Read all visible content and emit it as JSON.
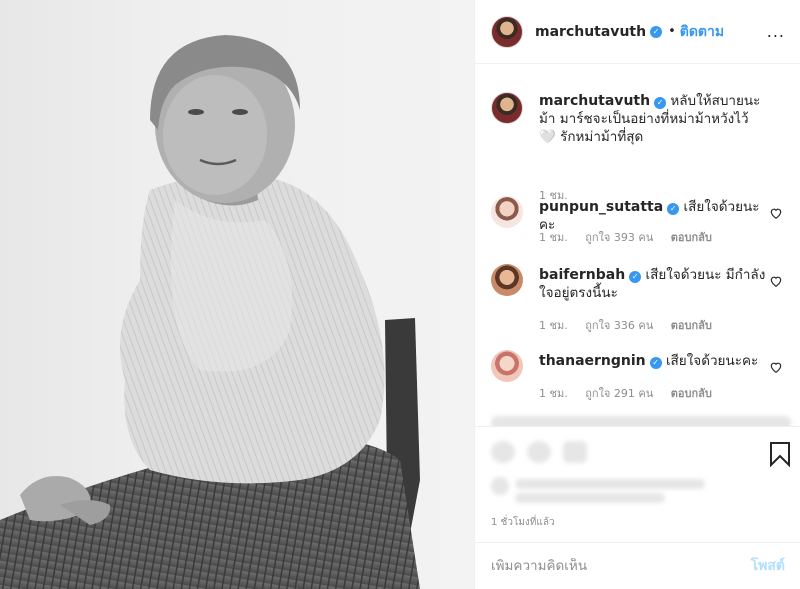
{
  "header": {
    "username": "marchutavuth",
    "separator": "•",
    "follow_label": "ติดตาม",
    "more_label": "..."
  },
  "caption": {
    "username": "marchutavuth",
    "text": "หลับให้สบายนะม้า มาร์ชจะเป็นอย่างที่หม่าม้าหวังไว้ 🤍 รักหม่าม้าที่สุด",
    "time": "1 ชม."
  },
  "comments": [
    {
      "username": "punpun_sutatta",
      "text": "เสียใจด้วยนะคะ",
      "time": "1 ชม.",
      "likes": "ถูกใจ 393 คน",
      "reply": "ตอบกลับ"
    },
    {
      "username": "baifernbah",
      "text": "เสียใจด้วยนะ มีกำลังใจอยู่ตรงนี้นะ",
      "time": "1 ชม.",
      "likes": "ถูกใจ 336 คน",
      "reply": "ตอบกลับ"
    },
    {
      "username": "thanaerngnin",
      "text": "เสียใจด้วยนะคะ",
      "time": "1 ชม.",
      "likes": "ถูกใจ 291 คน",
      "reply": "ตอบกลับ"
    }
  ],
  "footer": {
    "time_ago": "1 ชั่วโมงที่แล้ว",
    "comment_placeholder": "เพิ่มความคิดเห็น",
    "post_label": "โพสต์"
  },
  "colors": {
    "accent": "#3897f0",
    "post_disabled": "#b2dffc",
    "muted": "#8e8e8e"
  }
}
